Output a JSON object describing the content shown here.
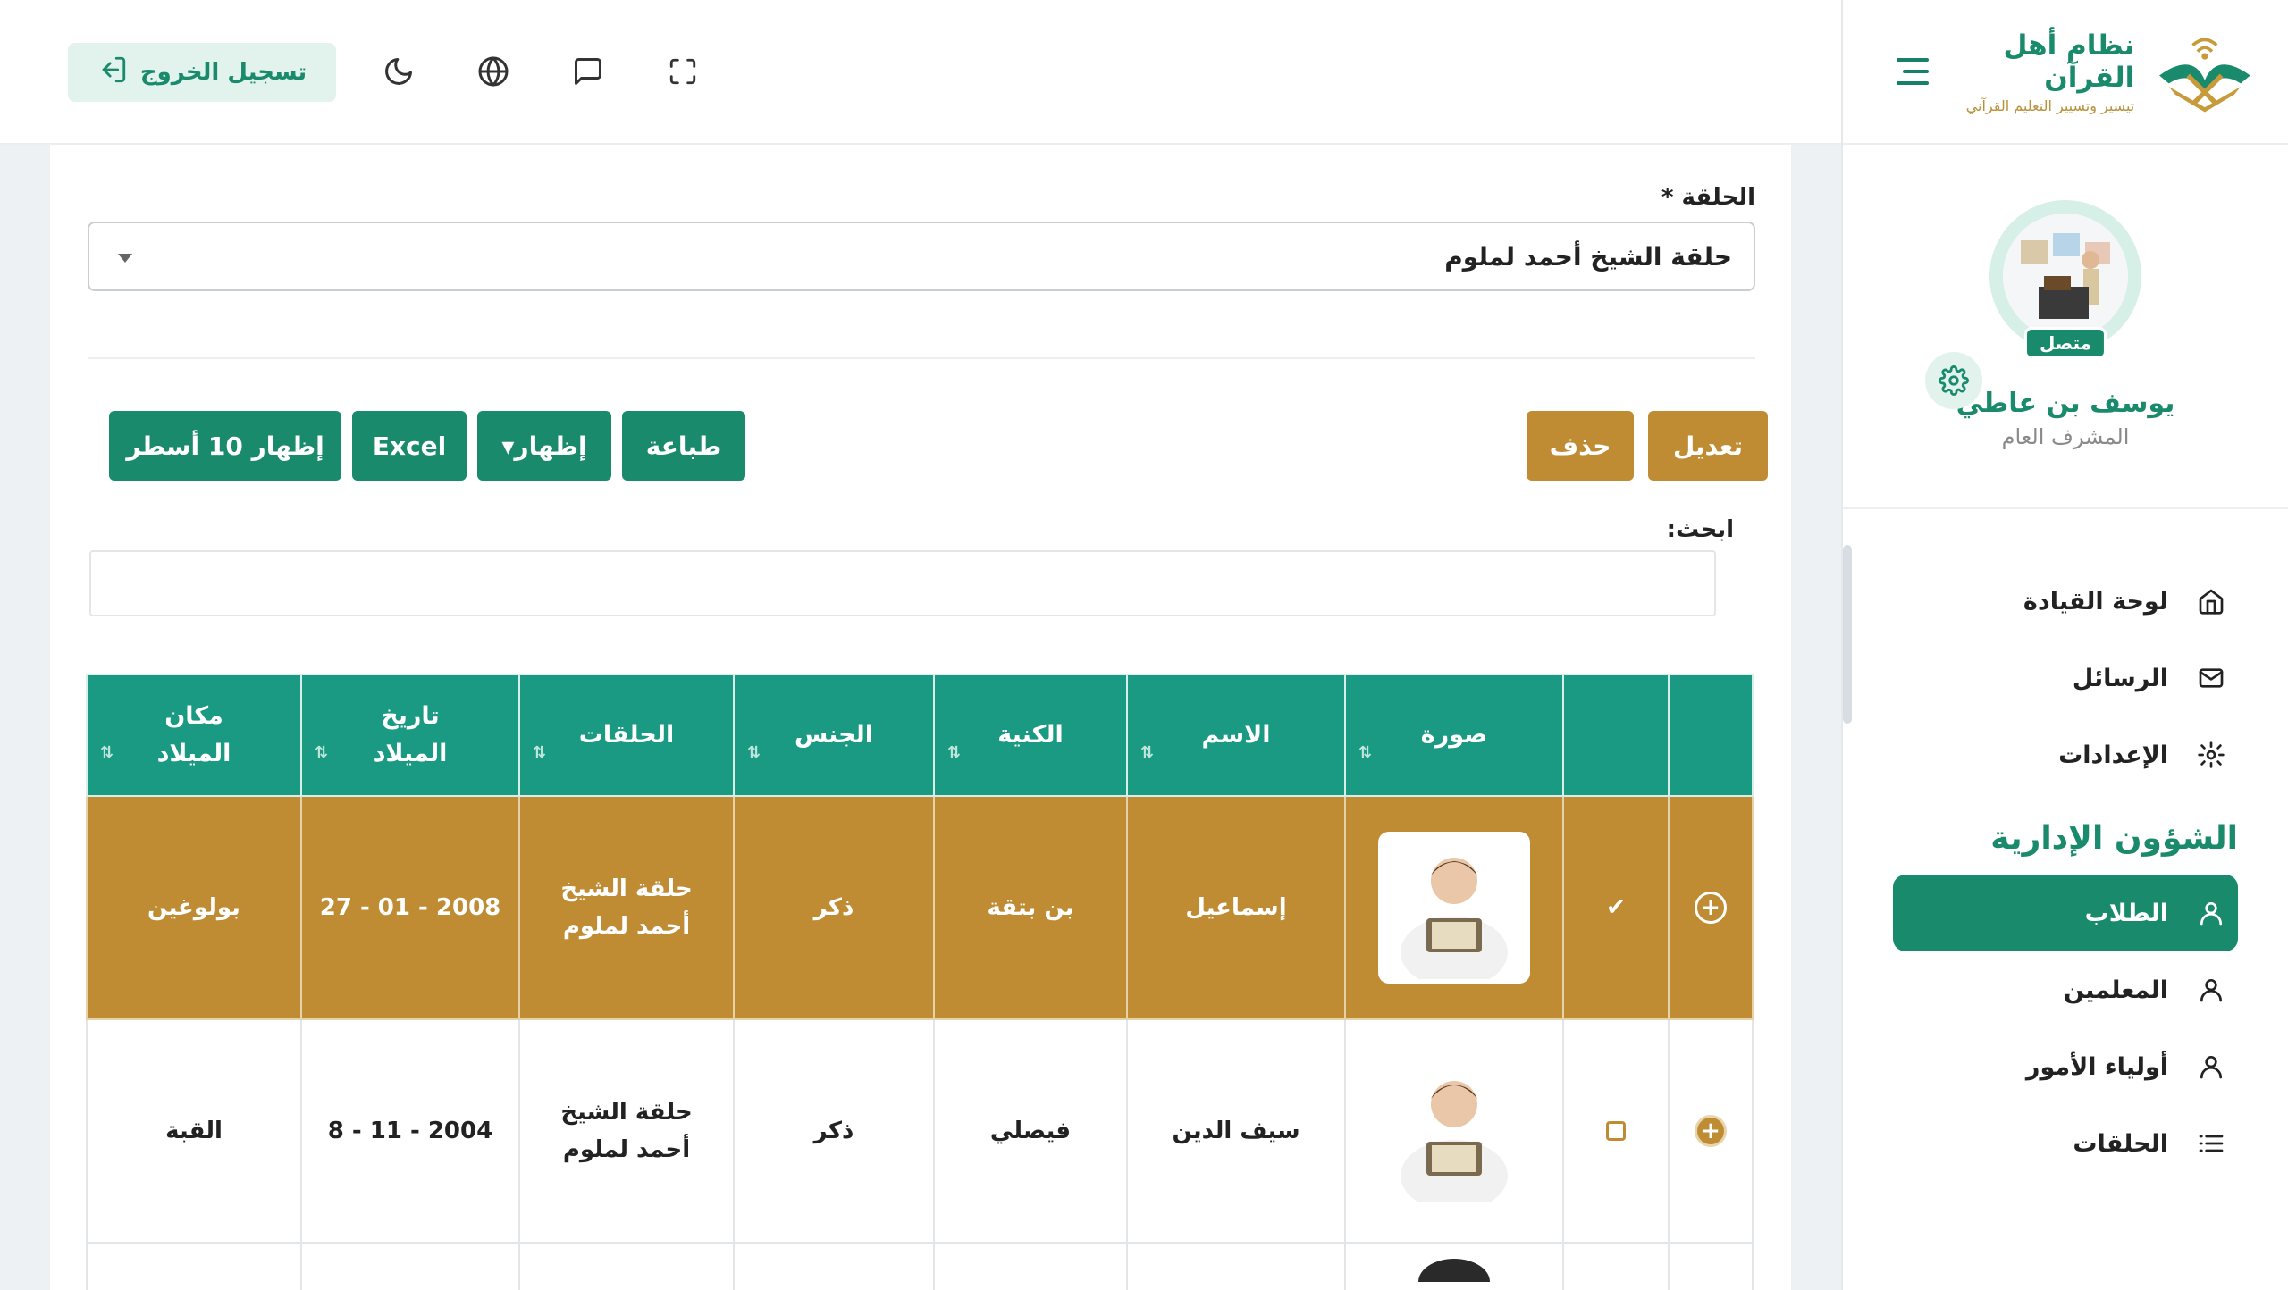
{
  "brand": {
    "title": "نظام أهل القرآن",
    "subtitle": "تيسير وتسيير التعليم القرآني"
  },
  "profile": {
    "name": "يوسف بن عاطي",
    "role": "المشرف العام",
    "status": "متصل"
  },
  "nav": {
    "items": [
      {
        "label": "لوحة القيادة",
        "icon": "home-icon"
      },
      {
        "label": "الرسائل",
        "icon": "mail-icon"
      },
      {
        "label": "الإعدادات",
        "icon": "gear-icon"
      }
    ],
    "section_title": "الشؤون الإدارية",
    "admin_items": [
      {
        "label": "الطلاب",
        "icon": "user-icon",
        "active": true
      },
      {
        "label": "المعلمين",
        "icon": "user-icon"
      },
      {
        "label": "أولياء الأمور",
        "icon": "user-icon"
      },
      {
        "label": "الحلقات",
        "icon": "list-icon"
      }
    ]
  },
  "topbar": {
    "logout_label": "تسجيل الخروج",
    "icons": [
      "moon-icon",
      "globe-icon",
      "chat-icon",
      "fullscreen-icon"
    ]
  },
  "form": {
    "halaqa_label": "الحلقة *",
    "halaqa_value": "حلقة الشيخ أحمد لملوم"
  },
  "actions": {
    "edit": "تعديل",
    "delete": "حذف",
    "print": "طباعة",
    "show": "إظهار▾",
    "excel": "Excel",
    "show_rows": "إظهار 10 أسطر"
  },
  "search": {
    "label": "ابحث:",
    "value": ""
  },
  "table": {
    "headers": {
      "photo": "صورة",
      "name": "الاسم",
      "kunya": "الكنية",
      "gender": "الجنس",
      "halaqat": "الحلقات",
      "birth_date": "تاريخ الميلاد",
      "birth_place": "مكان الميلاد"
    },
    "rows": [
      {
        "selected": true,
        "check": "✔",
        "name": "إسماعيل",
        "kunya": "بن بتقة",
        "gender": "ذكر",
        "halaqa": "حلقة الشيخ أحمد لملوم",
        "birth_date": "27 - 01 - 2008",
        "birth_place": "بولوغين"
      },
      {
        "selected": false,
        "name": "سيف الدين",
        "kunya": "فيصلي",
        "gender": "ذكر",
        "halaqa": "حلقة الشيخ أحمد لملوم",
        "birth_date": "8 - 11 - 2004",
        "birth_place": "القبة"
      }
    ]
  },
  "colors": {
    "primary": "#1a8a6d",
    "table_header": "#1a9a82",
    "gold": "#bf8c34"
  }
}
